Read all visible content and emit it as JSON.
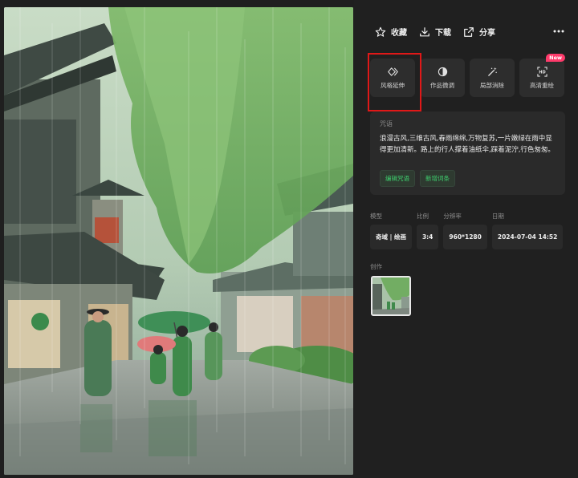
{
  "toolbar": {
    "favorite_label": "收藏",
    "download_label": "下载",
    "share_label": "分享"
  },
  "tools": [
    {
      "label": "风格延伸",
      "icon": "style-extend-icon",
      "highlighted": true
    },
    {
      "label": "作品微调",
      "icon": "fine-tune-icon"
    },
    {
      "label": "局部消除",
      "icon": "magic-wand-icon"
    },
    {
      "label": "高清重绘",
      "icon": "hd-icon",
      "badge": "New"
    }
  ],
  "prompt": {
    "label": "咒语",
    "text": "浪漫古风,三维古风,春雨绵绵,万物复苏,一片嫩绿在雨中显得更加清新。路上的行人撑着油纸伞,踩着泥泞,行色匆匆。",
    "edit_button": "编辑咒语",
    "add_button": "新增词条"
  },
  "meta": {
    "model_label": "模型",
    "model_value": "奇域 | 绘画",
    "ratio_label": "比例",
    "ratio_value": "3:4",
    "resolution_label": "分辨率",
    "resolution_value": "960*1280",
    "date_label": "日期",
    "date_value": "2024-07-04 14:52"
  },
  "works_label": "创作",
  "colors": {
    "accent_green": "#3ecf6e",
    "highlight_red": "#e01818",
    "new_badge": "#ff3b6b"
  }
}
